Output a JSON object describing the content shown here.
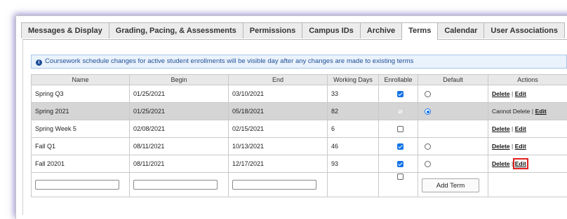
{
  "tabs": [
    {
      "label": "Messages & Display",
      "active": false
    },
    {
      "label": "Grading, Pacing, & Assessments",
      "active": false
    },
    {
      "label": "Permissions",
      "active": false
    },
    {
      "label": "Campus IDs",
      "active": false
    },
    {
      "label": "Archive",
      "active": false
    },
    {
      "label": "Terms",
      "active": true
    },
    {
      "label": "Calendar",
      "active": false
    },
    {
      "label": "User Associations",
      "active": false
    }
  ],
  "notice": {
    "icon": "info-icon",
    "text": "Coursework schedule changes for active student enrollments will be visible day after any changes are made to existing terms"
  },
  "table": {
    "headers": [
      "Name",
      "Begin",
      "End",
      "Working Days",
      "Enrollable",
      "Default",
      "Actions"
    ],
    "rows": [
      {
        "name": "Spring Q3",
        "begin": "01/25/2021",
        "end": "03/10/2021",
        "working_days": "33",
        "enrollable": true,
        "default": false,
        "shaded": false
      },
      {
        "name": "Spring 2021",
        "begin": "01/25/2021",
        "end": "05/18/2021",
        "working_days": "82",
        "enrollable": true,
        "default": true,
        "shaded": true
      },
      {
        "name": "Spring Week 5",
        "begin": "02/08/2021",
        "end": "02/15/2021",
        "working_days": "6",
        "enrollable": false,
        "default": false,
        "shaded": false
      },
      {
        "name": "Fall Q1",
        "begin": "08/11/2021",
        "end": "10/13/2021",
        "working_days": "46",
        "enrollable": true,
        "default": false,
        "shaded": false
      },
      {
        "name": "Fall 20201",
        "begin": "08/11/2021",
        "end": "12/17/2021",
        "working_days": "93",
        "enrollable": true,
        "default": false,
        "shaded": false
      }
    ],
    "actions": {
      "delete": "Delete",
      "edit": "Edit",
      "separator": "|",
      "cannot_delete": "Cannot Delete"
    }
  },
  "new_row": {
    "name_value": "",
    "begin_value": "",
    "end_value": "",
    "enrollable": false,
    "add_button": "Add Term"
  },
  "colors": {
    "accent": "#1473e6",
    "highlight": "#e02020",
    "shaded_row": "#d5d5d5",
    "notice_bg": "#eaf2fb"
  }
}
